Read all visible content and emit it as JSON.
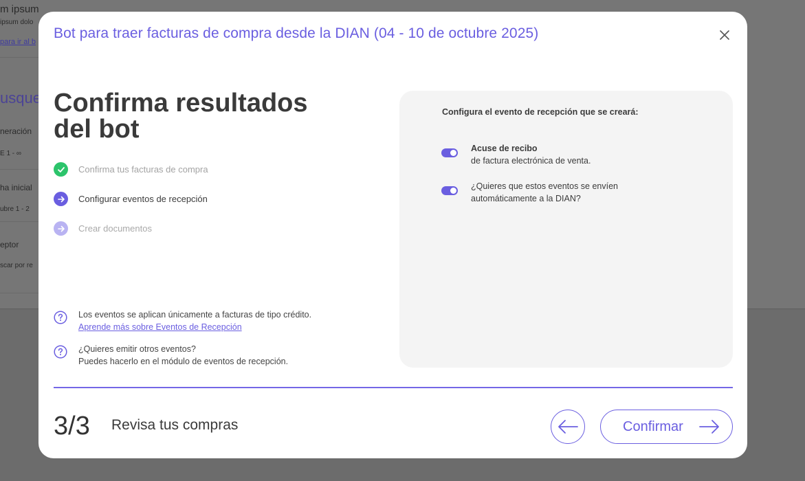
{
  "background": {
    "texts": [
      "m ipsum",
      "ipsum dolo",
      "para ir al b",
      "usque",
      "neración",
      "E 1 - ∞",
      "ha inicial",
      "ubre 1 - 2",
      "eptor",
      "scar por re"
    ]
  },
  "modal": {
    "title": "Bot para traer facturas de compra desde la DIAN (04 - 10 de octubre 2025)",
    "heading": "Confirma resultados del bot",
    "steps": [
      {
        "label": "Confirma tus facturas de compra",
        "state": "done"
      },
      {
        "label": "Configurar eventos de recepción",
        "state": "current"
      },
      {
        "label": "Crear documentos",
        "state": "pending"
      }
    ],
    "info": [
      {
        "text": "Los eventos se aplican únicamente a facturas de tipo crédito.",
        "link": "Aprende más sobre Eventos de Recepción"
      },
      {
        "line1": "¿Quieres emitir otros eventos?",
        "line2": "Puedes hacerlo en el módulo de eventos de recepción."
      }
    ],
    "panel": {
      "title": "Configura el evento de recepción que se creará:",
      "toggles": [
        {
          "line1": "Acuse de recibo",
          "line2": "de factura electrónica de venta.",
          "on": true
        },
        {
          "line1": "¿Quieres que estos eventos se envíen",
          "line2": "automáticamente a la DIAN?",
          "on": true
        }
      ]
    },
    "footer": {
      "step_count": "3/3",
      "step_label": "Revisa tus compras",
      "confirm_label": "Confirmar"
    }
  },
  "colors": {
    "accent": "#6a5ee0",
    "success": "#2cc46b",
    "pending": "#b9b3f2"
  }
}
